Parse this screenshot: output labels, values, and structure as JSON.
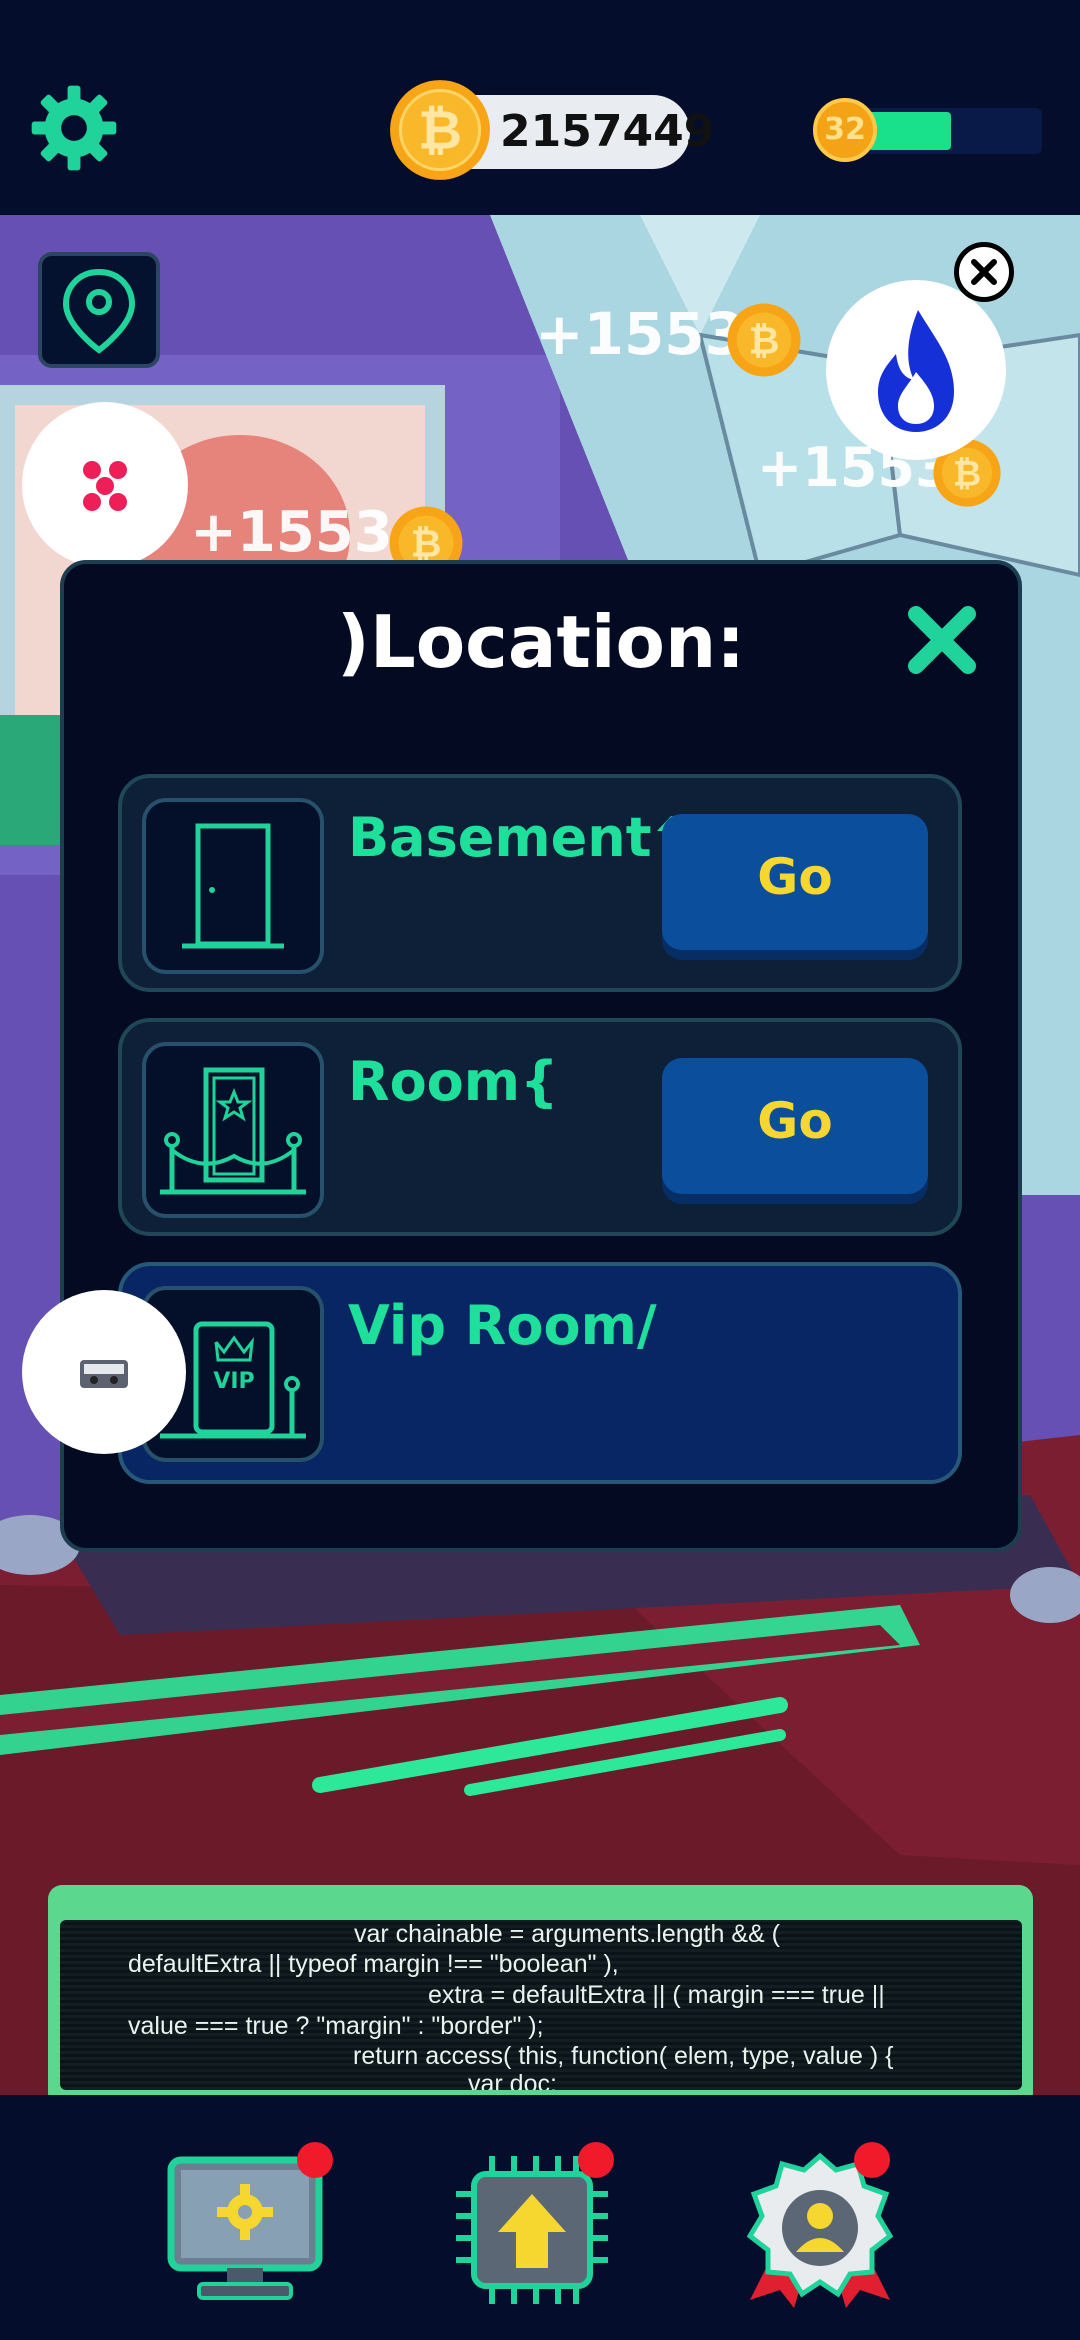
{
  "header": {
    "coin_balance": "2157449",
    "level": "32",
    "level_progress": 0.5
  },
  "floaters": [
    "+1553",
    "+1553",
    "+1553"
  ],
  "modal": {
    "title": ")Location:",
    "locations": [
      {
        "name": "Basement^",
        "action": "Go"
      },
      {
        "name": "Room{",
        "action": "Go"
      },
      {
        "name": "Vip Room/",
        "action": ""
      }
    ]
  },
  "console": {
    "lines": [
      "var chainable = arguments.length && (",
      "defaultExtra || typeof margin !== \"boolean\" ),",
      "extra = defaultExtra || ( margin === true ||",
      "value === true ? \"margin\" : \"border\" );",
      "return access( this, function( elem, type, value ) {",
      "var doc;"
    ]
  },
  "bottom_nav": [
    {
      "icon": "monitor-settings-icon",
      "badge": true
    },
    {
      "icon": "chip-upgrade-icon",
      "badge": true
    },
    {
      "icon": "profile-badge-icon",
      "badge": true
    }
  ],
  "colors": {
    "accent": "#1ee09a",
    "button": "#0b4e9c",
    "button_text": "#f5d730",
    "badge": "#f01a2b"
  }
}
